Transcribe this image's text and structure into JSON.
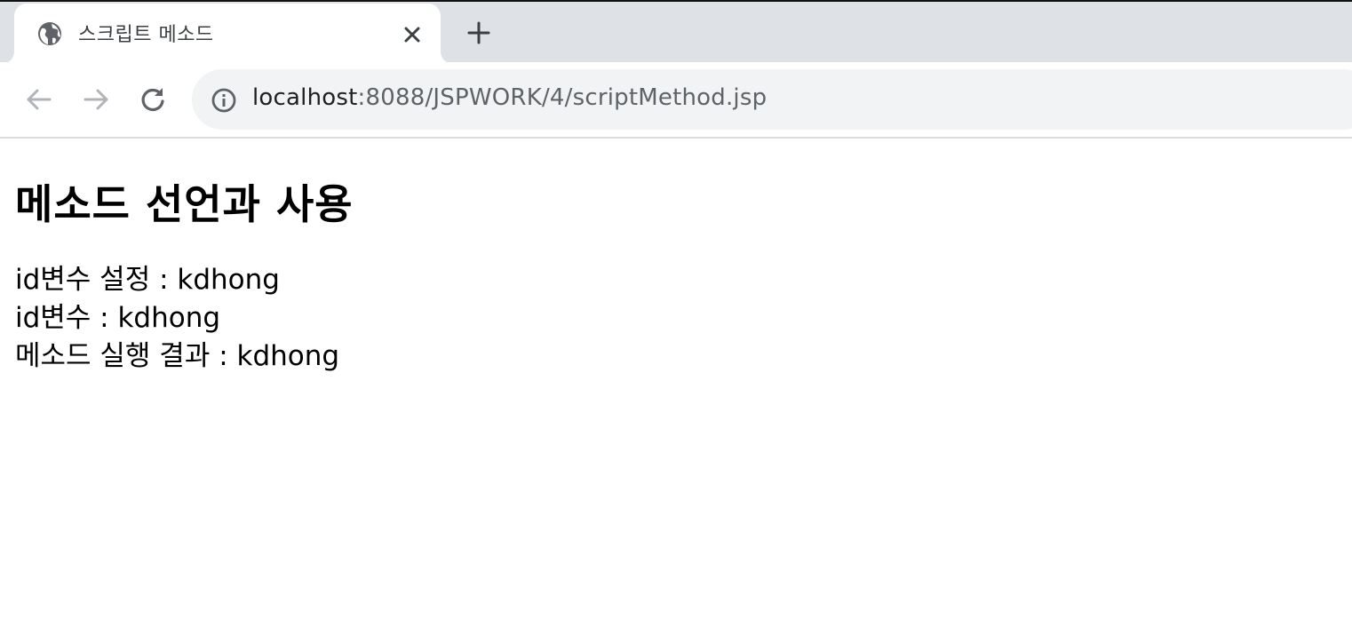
{
  "browser": {
    "tab": {
      "title": "스크립트 메소드",
      "favicon": "globe-icon",
      "close_icon": "close-icon"
    },
    "new_tab_icon": "plus-icon",
    "nav": {
      "back_icon": "arrow-left-icon",
      "forward_icon": "arrow-right-icon",
      "reload_icon": "reload-icon"
    },
    "address_bar": {
      "info_icon": "info-icon",
      "url_host": "localhost",
      "url_path": ":8088/JSPWORK/4/scriptMethod.jsp"
    }
  },
  "page": {
    "heading": "메소드 선언과 사용",
    "lines": [
      "id변수 설정 : kdhong",
      "id변수 : kdhong",
      "메소드 실행 결과 : kdhong"
    ]
  },
  "colors": {
    "tabstrip_bg": "#dee1e6",
    "omnibox_bg": "#f1f3f4",
    "icon_dark": "#5f6368",
    "icon_disabled": "#b0b3b8"
  }
}
